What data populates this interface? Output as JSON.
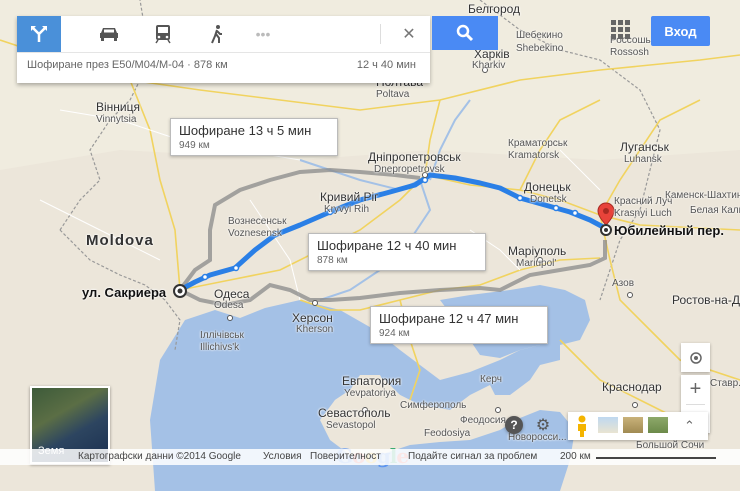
{
  "travel_modes": {
    "items": [
      {
        "name": "directions-icon",
        "active": true
      },
      {
        "name": "car-icon",
        "active": false
      },
      {
        "name": "transit-icon",
        "active": false
      },
      {
        "name": "walking-icon",
        "active": false
      },
      {
        "name": "more-icon",
        "active": false
      }
    ],
    "close_label": "✕"
  },
  "route_summary": {
    "text": "Шофиране през E50/M04/M-04 · 878 км",
    "time": "12 ч 40 мин"
  },
  "header": {
    "signin_label": "Вход"
  },
  "routes": [
    {
      "title": "Шофиране 13 ч 5 мин",
      "distance": "949 км"
    },
    {
      "title": "Шофиране 12 ч 40 мин",
      "distance": "878 км"
    },
    {
      "title": "Шофиране 12 ч 47 мин",
      "distance": "924 км"
    }
  ],
  "start_label": "ул. Сакриера",
  "end_label": "Юбилейный пер.",
  "cities": {
    "belgorod": "Белгород",
    "kharkiv_ua": "Харків",
    "kharkiv": "Kharkiv",
    "shebekino_ru": "Шебекино",
    "shebekino": "Shebekino",
    "rossosh_ru": "Россошь",
    "rossosh": "Rossosh",
    "poltava_ua": "Полтава",
    "poltava": "Poltava",
    "vinnytsia_ua": "Вінниця",
    "vinnytsia": "Vinnytsia",
    "dnipro_ua": "Дніпропетровськ",
    "dnipro": "Dnepropetrovsk",
    "kramatorsk_ua": "Краматорськ",
    "kramatorsk": "Kramatorsk",
    "luhansk_ua": "Луганськ",
    "luhansk": "Luhansk",
    "donetsk_ua": "Донецьк",
    "donetsk": "Donetsk",
    "krasnyi_luch_ru": "Красний Луч",
    "krasnyi_luch": "Krasnyi Luch",
    "kryvyi_rih_ua": "Кривий Ріг",
    "kryvyi_rih": "Kryvyi Rih",
    "voznesensk_ua": "Вознесенськ",
    "voznesensk": "Voznesensk",
    "moldova": "Moldova",
    "odesa_ua": "Одеса",
    "odesa": "Odesa",
    "illichivsk_ua": "Іллічівськ",
    "illichivsk": "Illichivs'k",
    "kherson_ua": "Херсон",
    "kherson": "Kherson",
    "mariupol_ua": "Маріуполь",
    "mariupol": "Mariupol'",
    "azov": "Азов",
    "rostov": "Ростов-на-Дону",
    "belaya_kalitva": "Белая Калитва",
    "kamensk": "Каменск-Шахтинский",
    "yevpatoria_ua": "Евпатория",
    "yevpatoria": "Yevpatoriya",
    "simferopol": "Симферополь",
    "sevastopol_ua": "Севастополь",
    "sevastopol": "Sevastopol",
    "feodosia_ua": "Феодосия",
    "feodosia": "Feodosiya",
    "kerch": "Керч",
    "krasnodar": "Краснодар",
    "novorossiysk": "Новоросси...",
    "sochi": "Большой Сочи",
    "stavropol": "Ставр..."
  },
  "footer": {
    "copyright": "Картографски данни ©2014 Google",
    "terms": "Условия",
    "privacy": "Поверителност",
    "report": "Подайте сигнал за проблем",
    "scale": "200 км"
  },
  "earth_label": "Земя",
  "colors": {
    "route_active": "#2a7fe6",
    "route_alt": "#8a8a8a",
    "sea": "#a4c1e6",
    "land": "#ece6da",
    "accent": "#4a8af4"
  }
}
